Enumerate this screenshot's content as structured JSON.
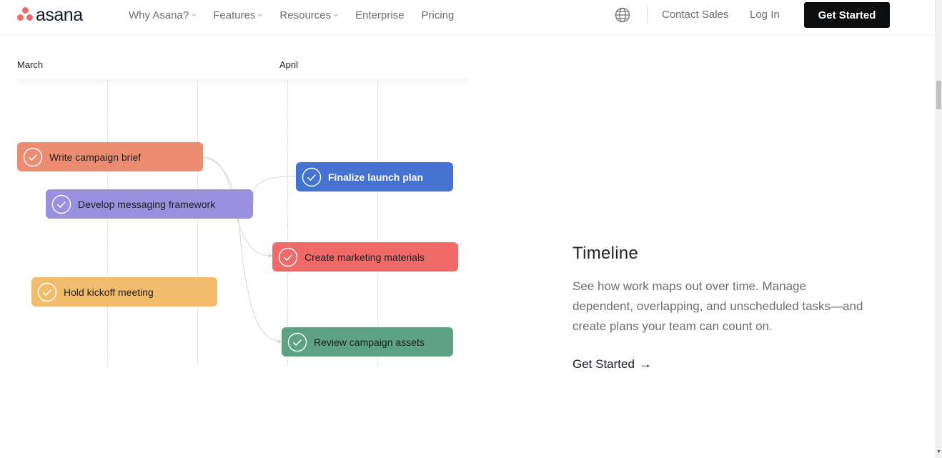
{
  "header": {
    "logo_text": "asana",
    "nav": [
      {
        "label": "Why Asana?",
        "has_dropdown": true
      },
      {
        "label": "Features",
        "has_dropdown": true
      },
      {
        "label": "Resources",
        "has_dropdown": true
      },
      {
        "label": "Enterprise",
        "has_dropdown": false
      },
      {
        "label": "Pricing",
        "has_dropdown": false
      }
    ],
    "language_icon": "globe-icon",
    "contact_label": "Contact Sales",
    "login_label": "Log In",
    "cta_label": "Get Started"
  },
  "timeline": {
    "months": [
      "March",
      "April"
    ],
    "tasks": [
      {
        "label": "Write campaign brief",
        "color": "#ec8d71",
        "text_color": "#1e1f21"
      },
      {
        "label": "Develop messaging framework",
        "color": "#9b8fe0",
        "text_color": "#1e1f21"
      },
      {
        "label": "Hold kickoff meeting",
        "color": "#f1bd6c",
        "text_color": "#1e1f21"
      },
      {
        "label": "Finalize launch plan",
        "color": "#4573d2",
        "text_color": "#ffffff"
      },
      {
        "label": "Create marketing materials",
        "color": "#f06a6a",
        "text_color": "#1e1f21"
      },
      {
        "label": "Review campaign assets",
        "color": "#5da283",
        "text_color": "#1e1f21"
      }
    ]
  },
  "feature": {
    "title": "Timeline",
    "description": "See how work maps out over time. Manage dependent, overlapping, and unscheduled tasks—and create plans your team can count on.",
    "cta_label": "Get Started",
    "cta_arrow": "→"
  },
  "colors": {
    "brand": "#f06a6a",
    "cta_bg": "#0d0e10"
  }
}
